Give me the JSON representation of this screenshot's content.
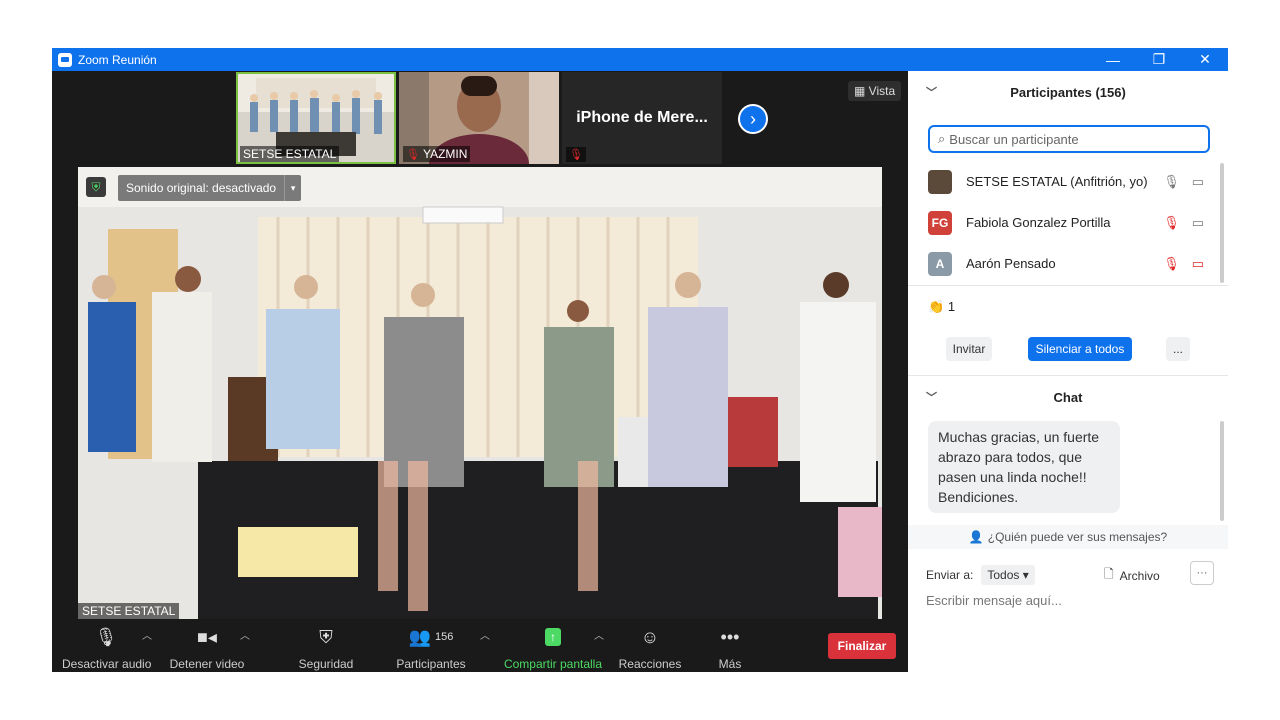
{
  "window": {
    "title": "Zoom Reunión",
    "minimize": "—",
    "restore": "❐",
    "close": "✕"
  },
  "stage": {
    "view_label": "Vista",
    "thumbnails": [
      {
        "name": "SETSE ESTATAL",
        "muted": false
      },
      {
        "name": "YAZMIN",
        "muted": true
      },
      {
        "name": "iPhone de Mere...",
        "muted": true
      }
    ],
    "main_video": {
      "name": "SETSE ESTATAL",
      "sound_label": "Sonido original: desactivado"
    }
  },
  "toolbar": {
    "mute": "Desactivar audio",
    "video": "Detener video",
    "security": "Seguridad",
    "participants": "Participantes",
    "participants_count": "156",
    "share": "Compartir pantalla",
    "reactions": "Reacciones",
    "more": "Más",
    "end": "Finalizar"
  },
  "participants_panel": {
    "title": "Participantes (156)",
    "search_placeholder": "Buscar un participante",
    "items": [
      {
        "initials": "",
        "name": "SETSE ESTATAL (Anfitrión, yo)",
        "avatar_color": "#5b4a3a",
        "mic": "on",
        "video": "on"
      },
      {
        "initials": "FG",
        "name": "Fabiola Gonzalez Portilla",
        "avatar_color": "#d0413a",
        "mic": "muted",
        "video": "on"
      },
      {
        "initials": "A",
        "name": "Aarón Pensado",
        "avatar_color": "#8a9aa6",
        "mic": "muted",
        "video": "off"
      }
    ],
    "reaction": "👏",
    "reaction_count": "1",
    "invite": "Invitar",
    "mute_all": "Silenciar a todos",
    "more": "..."
  },
  "chat": {
    "title": "Chat",
    "message": "Muchas gracias, un fuerte abrazo para todos, que pasen una linda noche!! Bendiciones.",
    "who_can_see": "¿Quién puede ver sus mensajes?",
    "send_to_label": "Enviar a:",
    "send_to_value": "Todos",
    "file_label": "Archivo",
    "input_placeholder": "Escribir mensaje aquí..."
  },
  "colors": {
    "accent": "#0e72ed",
    "end": "#d9323a",
    "share": "#4cd964"
  }
}
